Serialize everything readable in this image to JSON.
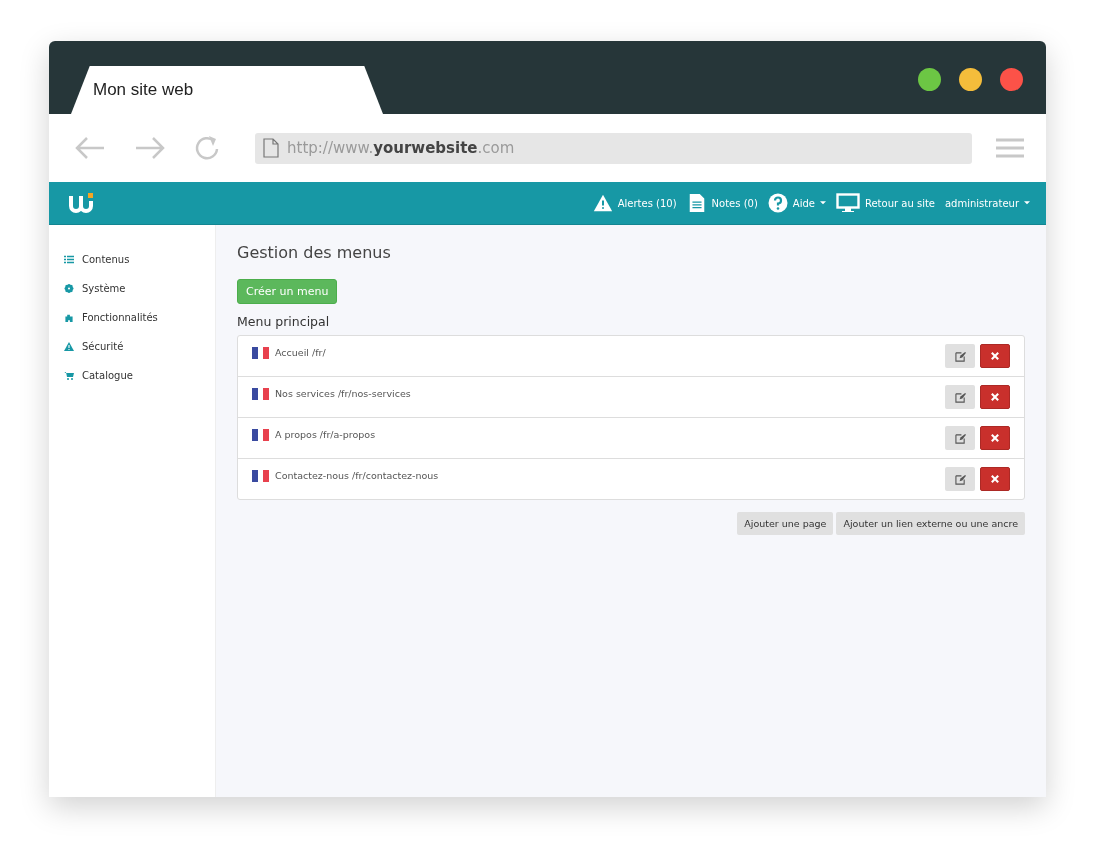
{
  "browser": {
    "tab_title": "Mon site web",
    "url": "http://www.**yourwebsite**.com"
  },
  "navbar": {
    "items": [
      {
        "label": "Alertes (10)",
        "dropdown": false
      },
      {
        "label": "Notes (0)",
        "dropdown": false
      },
      {
        "label": "Aide",
        "dropdown": true
      },
      {
        "label": "Retour au site",
        "dropdown": false
      },
      {
        "label": "administrateur",
        "dropdown": true
      }
    ]
  },
  "sidebar": {
    "items": [
      {
        "label": "Contenus"
      },
      {
        "label": "Système"
      },
      {
        "label": "Fonctionnalités"
      },
      {
        "label": "Sécurité"
      },
      {
        "label": "Catalogue"
      }
    ]
  },
  "page": {
    "title": "Gestion des menus",
    "create_button": "Créer un menu",
    "menu_title": "Menu principal",
    "entries": [
      {
        "label": "Accueil /fr/"
      },
      {
        "label": "Nos services /fr/nos-services"
      },
      {
        "label": "A propos /fr/a-propos"
      },
      {
        "label": "Contactez-nous /fr/contactez-nous"
      }
    ],
    "buttons": [
      "Ajouter une page",
      "Ajouter un lien externe ou une ancre"
    ]
  }
}
